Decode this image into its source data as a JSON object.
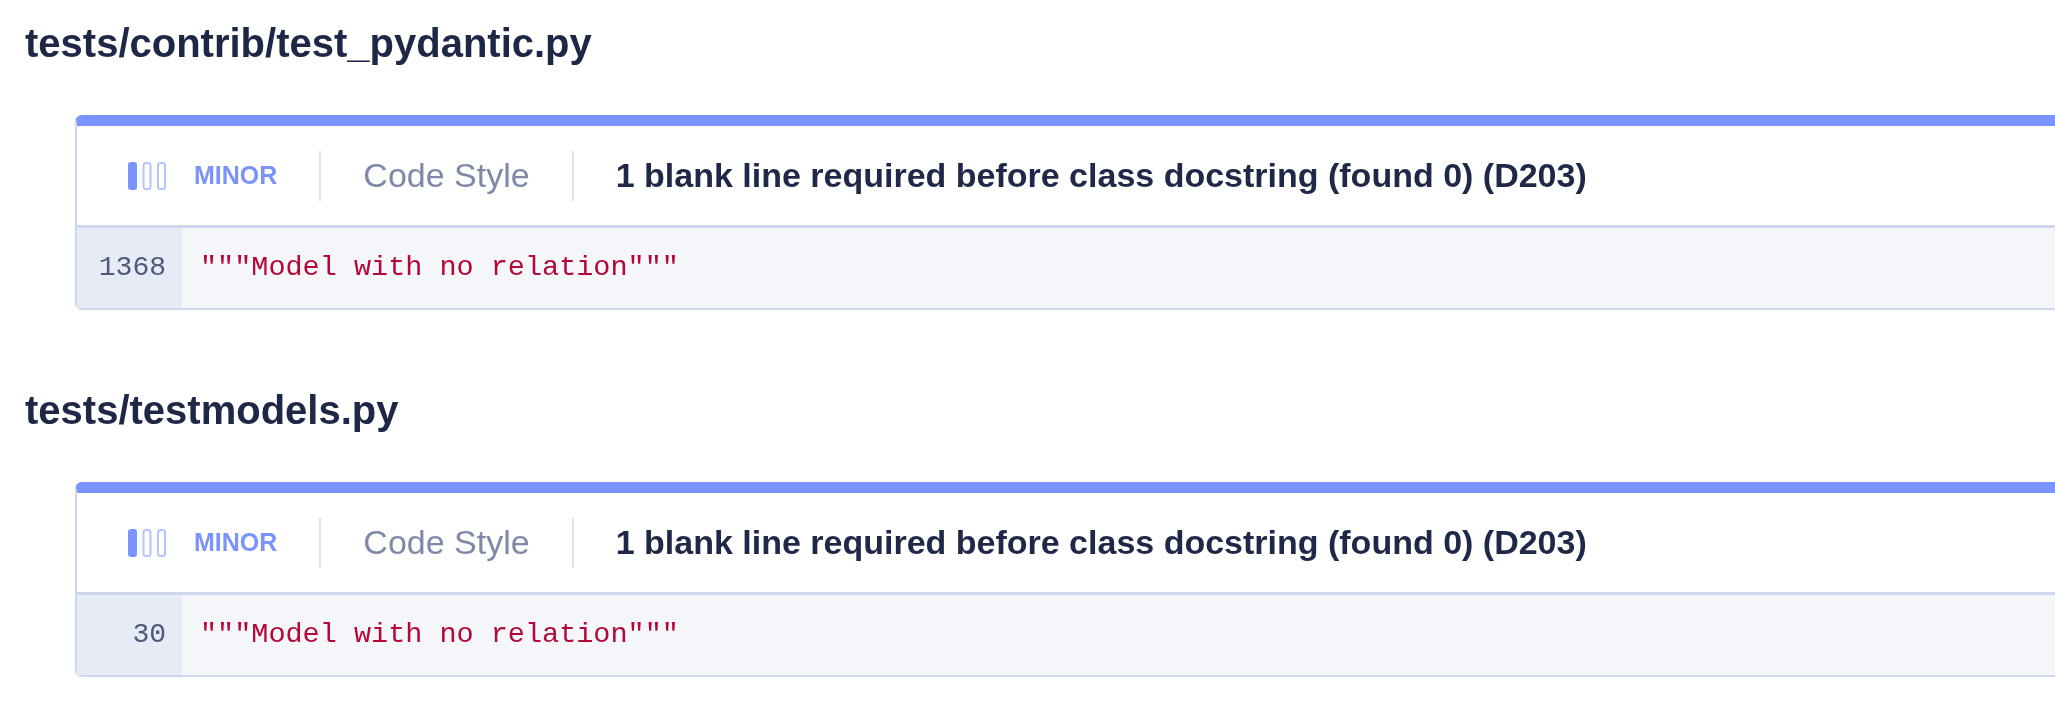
{
  "files": [
    {
      "path": "tests/contrib/test_pydantic.py",
      "issues": [
        {
          "severity": {
            "label": "MINOR",
            "level": 0.33
          },
          "category": "Code Style",
          "message": "1 blank line required before class docstring (found 0) (D203)",
          "lines": [
            {
              "number": "1368",
              "code": "\"\"\"Model with no relation\"\"\""
            }
          ]
        }
      ]
    },
    {
      "path": "tests/testmodels.py",
      "issues": [
        {
          "severity": {
            "label": "MINOR",
            "level": 0.33
          },
          "category": "Code Style",
          "message": "1 blank line required before class docstring (found 0) (D203)",
          "lines": [
            {
              "number": "30",
              "code": "\"\"\"Model with no relation\"\"\""
            }
          ]
        }
      ]
    }
  ]
}
